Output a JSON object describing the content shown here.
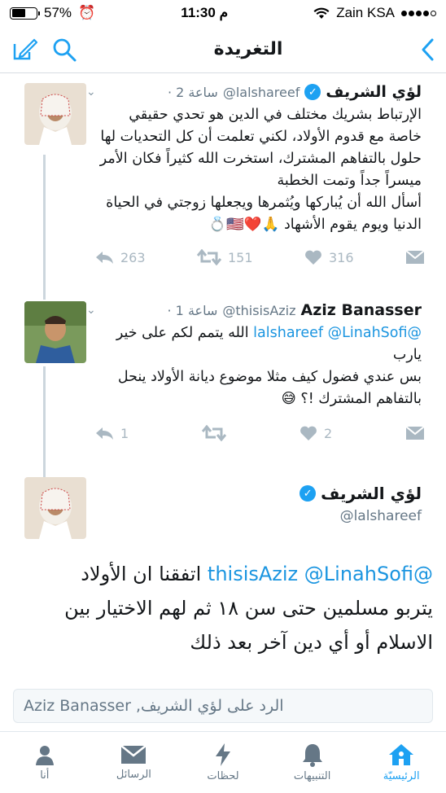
{
  "status": {
    "battery": "57%",
    "battery_level": 0.57,
    "time": "11:30 م",
    "carrier": "Zain KSA"
  },
  "nav": {
    "title": "التغريدة"
  },
  "tweets": [
    {
      "name": "لؤي الشريف",
      "handle": "@lalshareef",
      "time": "2 ساعة",
      "text_lines": [
        "الإرتباط بشريك مختلف في الدين هو تحدي حقيقي",
        "خاصة مع قدوم الأولاد، لكني تعلمت أن كل التحديات لها",
        "حلول بالتفاهم المشترك، استخرت الله كثيراً فكان الأمر",
        "ميسراً جداً وتمت الخطبة",
        "أسأل الله أن يُباركها ويُثمرها ويجعلها زوجتي في الحياة",
        "الدنيا ويوم يقوم الأشهاد 🙏❤️🇺🇸💍"
      ],
      "replies": "263",
      "retweets": "151",
      "likes": "316"
    },
    {
      "name": "Aziz Banasser",
      "handle": "@thisisAziz",
      "time": "1 ساعة",
      "mention1": "@lalshareef",
      "mention2": "@LinahSofi",
      "text_after_mentions": "الله يتمم لكم على خير",
      "text_lines": [
        "يارب",
        "بس عندي فضول كيف مثلا موضوع ديانة الأولاد ينحل",
        "بالتفاهم المشترك !؟ 😅"
      ],
      "replies": "1",
      "likes": "2"
    },
    {
      "name": "لؤي الشريف",
      "handle": "@lalshareef",
      "mention1": "@thisisAziz",
      "mention2": "@LinahSofi",
      "text_after_mentions": "اتفقنا ان الأولاد",
      "text_lines": [
        "يتربو مسلمين حتى سن ١٨ ثم لهم الاختيار بين",
        "الاسلام أو أي دين آخر بعد ذلك"
      ]
    }
  ],
  "reply_box": {
    "placeholder": "الرد على لؤي الشريف, Aziz Banasser"
  },
  "tabs": [
    {
      "label": "أنا",
      "icon": "person-icon"
    },
    {
      "label": "الرسائل",
      "icon": "envelope-icon"
    },
    {
      "label": "لحظات",
      "icon": "lightning-icon"
    },
    {
      "label": "التنبيهات",
      "icon": "bell-icon"
    },
    {
      "label": "الرئيسيّة",
      "icon": "home-icon"
    }
  ],
  "colors": {
    "accent": "#1da1f2",
    "mention": "#1b95e0",
    "muted": "#aab8c2"
  }
}
